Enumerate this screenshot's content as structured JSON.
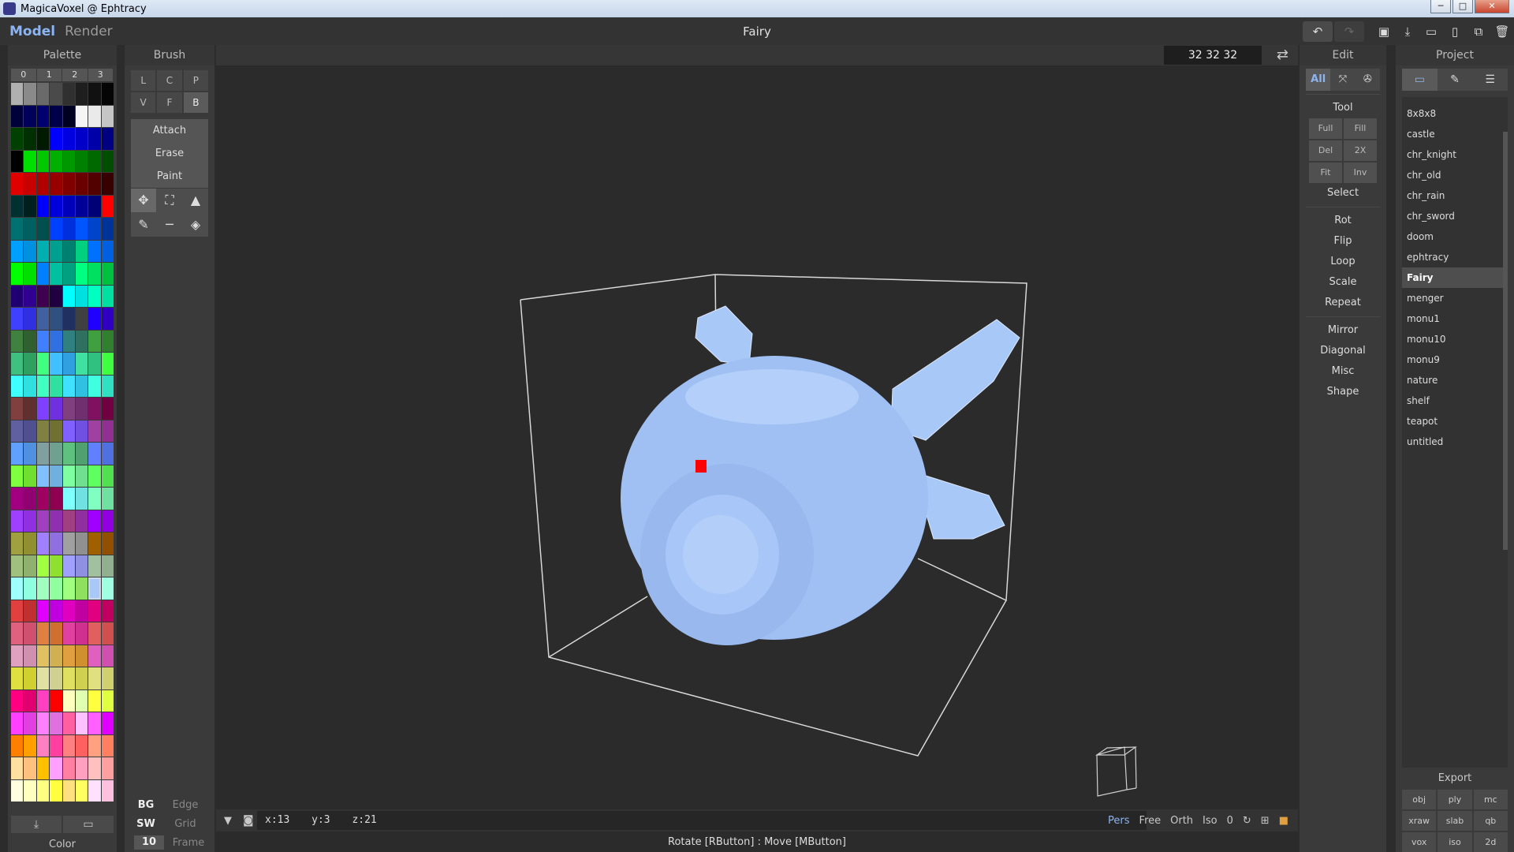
{
  "window": {
    "title": "MagicaVoxel @ Ephtracy",
    "minimize": "─",
    "maximize": "□",
    "close": "✕"
  },
  "menu": {
    "model": "Model",
    "render": "Render",
    "doc_title": "Fairy"
  },
  "palette": {
    "title": "Palette",
    "tabs": [
      "0",
      "1",
      "2",
      "3"
    ],
    "label": "Color",
    "colors": [
      "#b0b0b0",
      "#8a8a8a",
      "#6a6a6a",
      "#4a4a4a",
      "#303030",
      "#1e1e1e",
      "#111111",
      "#050505",
      "#00003a",
      "#000058",
      "#00006e",
      "#00004a",
      "#000022",
      "#f5f5f5",
      "#eaeaea",
      "#c5c5c5",
      "#004000",
      "#003000",
      "#001a00",
      "#0000ff",
      "#0000e0",
      "#0000c8",
      "#0000a8",
      "#000080",
      "#000000",
      "#00e000",
      "#00c800",
      "#00b000",
      "#009800",
      "#008000",
      "#006a00",
      "#004e00",
      "#e00000",
      "#c80000",
      "#b00000",
      "#980000",
      "#800000",
      "#6a0000",
      "#520000",
      "#380000",
      "#003030",
      "#002020",
      "#0000ff",
      "#0000dd",
      "#0000bb",
      "#000099",
      "#000077",
      "#ff0000",
      "#007070",
      "#006060",
      "#005050",
      "#0040ff",
      "#0030dd",
      "#0055ff",
      "#0044cc",
      "#003399",
      "#00a0ff",
      "#0090e0",
      "#00b0b0",
      "#00a090",
      "#008070",
      "#00d080",
      "#0070ff",
      "#0060e0",
      "#00ff00",
      "#00e000",
      "#0080ff",
      "#00c0a0",
      "#00a080",
      "#00ff80",
      "#00e060",
      "#00c040",
      "#200070",
      "#300090",
      "#400050",
      "#200040",
      "#00ffff",
      "#00e0e0",
      "#00ffc0",
      "#00e0a0",
      "#4040ff",
      "#3030e0",
      "#4060a0",
      "#305080",
      "#203060",
      "#404040",
      "#2000ff",
      "#3000c0",
      "#408040",
      "#306030",
      "#4080ff",
      "#3070e0",
      "#308080",
      "#307060",
      "#40a040",
      "#308030",
      "#40c080",
      "#30a060",
      "#40ff80",
      "#40c0ff",
      "#30a0e0",
      "#40e0a0",
      "#30c080",
      "#40ff40",
      "#40ffff",
      "#30e0e0",
      "#40ffc0",
      "#30e0a0",
      "#40e0ff",
      "#30c0e0",
      "#40ffe0",
      "#30e0c0",
      "#804040",
      "#603030",
      "#8040ff",
      "#7030e0",
      "#804080",
      "#703070",
      "#801060",
      "#700040",
      "#6060a0",
      "#505090",
      "#808040",
      "#707030",
      "#8060ff",
      "#7050e0",
      "#a040a0",
      "#903090",
      "#60a0ff",
      "#5090e0",
      "#80a0a0",
      "#70a090",
      "#60c080",
      "#50a070",
      "#6080ff",
      "#5070e0",
      "#80ff40",
      "#70e030",
      "#80c0ff",
      "#70b0e0",
      "#80ffa0",
      "#70e090",
      "#60ff60",
      "#50e050",
      "#a00080",
      "#900070",
      "#a00060",
      "#900050",
      "#80ffff",
      "#70e0e0",
      "#80ffc0",
      "#70e0a0",
      "#a040ff",
      "#9030e0",
      "#a040c0",
      "#9030b0",
      "#a04080",
      "#9030a0",
      "#a000ff",
      "#9000e0",
      "#a0a040",
      "#909030",
      "#a080ff",
      "#9070e0",
      "#a0a0a0",
      "#909090",
      "#a06000",
      "#905000",
      "#a0c080",
      "#90b070",
      "#a0ff40",
      "#90e030",
      "#a0a0ff",
      "#9090e0",
      "#a0c0a0",
      "#90b090",
      "#a0ffff",
      "#90ffe0",
      "#a0ffc0",
      "#90ffa0",
      "#a0ff80",
      "#90e060",
      "#a8c8f8",
      "#a0ffe0",
      "#e04040",
      "#c03030",
      "#e000ff",
      "#c000e0",
      "#e000c0",
      "#c000a0",
      "#e00080",
      "#c00060",
      "#e06080",
      "#d05070",
      "#e08040",
      "#d07030",
      "#e040a0",
      "#d03090",
      "#e06060",
      "#d05050",
      "#e0a0c0",
      "#d090b0",
      "#e0c060",
      "#d0b050",
      "#e0a040",
      "#d09030",
      "#e060c0",
      "#d050b0",
      "#e0e040",
      "#d0d030",
      "#e0e0a0",
      "#d0d090",
      "#e0e060",
      "#d0d050",
      "#e0e080",
      "#d0d070",
      "#ff0080",
      "#e00070",
      "#ff40c0",
      "#ff0000",
      "#ffffc0",
      "#e0ffb0",
      "#ffff40",
      "#e0ff40",
      "#ff40ff",
      "#e040e0",
      "#ff80ff",
      "#e070e0",
      "#ff60a0",
      "#ffc0ff",
      "#ff60ff",
      "#e000ff",
      "#ff8000",
      "#ffa000",
      "#ff80c0",
      "#ff40a0",
      "#ff8080",
      "#ff6060",
      "#ffa080",
      "#ff8060",
      "#ffe0a0",
      "#ffc080",
      "#ffc000",
      "#ffa0ff",
      "#ff80a0",
      "#ffa0c0",
      "#ffc0c0",
      "#ffa0a0",
      "#ffffe0",
      "#ffffc0",
      "#ffff80",
      "#ffff40",
      "#ffe080",
      "#ffff60",
      "#ffe0ff",
      "#ffc0e0"
    ]
  },
  "brush": {
    "title": "Brush",
    "modes": [
      "L",
      "C",
      "P",
      "V",
      "F",
      "B"
    ],
    "actions": [
      "Attach",
      "Erase",
      "Paint"
    ],
    "footer": {
      "bg": "BG",
      "edge": "Edge",
      "sw": "SW",
      "grid": "Grid",
      "frame_num": "10",
      "frame": "Frame"
    }
  },
  "viewport": {
    "size": "32 32 32",
    "coords": {
      "x": "x:13",
      "y": "y:3",
      "z": "z:21"
    },
    "view_modes": [
      "Pers",
      "Free",
      "Orth",
      "Iso",
      "0"
    ],
    "status": "Rotate [RButton] : Move [MButton]"
  },
  "edit": {
    "title": "Edit",
    "tabs": [
      "All"
    ],
    "tool_title": "Tool",
    "tools": [
      "Full",
      "Fill",
      "Del",
      "2X",
      "Fit",
      "Inv"
    ],
    "select": "Select",
    "ops1": [
      "Rot",
      "Flip",
      "Loop",
      "Scale",
      "Repeat"
    ],
    "ops2": [
      "Mirror",
      "Diagonal",
      "Misc",
      "Shape"
    ]
  },
  "project": {
    "title": "Project",
    "items": [
      "8x8x8",
      "castle",
      "chr_knight",
      "chr_old",
      "chr_rain",
      "chr_sword",
      "doom",
      "ephtracy",
      "Fairy",
      "menger",
      "monu1",
      "monu10",
      "monu9",
      "nature",
      "shelf",
      "teapot",
      "untitled"
    ],
    "export_title": "Export",
    "export": [
      "obj",
      "ply",
      "mc",
      "xraw",
      "slab",
      "qb",
      "vox",
      "iso",
      "2d"
    ]
  },
  "colors": {
    "accent": "#8db4f0",
    "voxel": "#a8c8f8",
    "marker": "#ff0000"
  }
}
